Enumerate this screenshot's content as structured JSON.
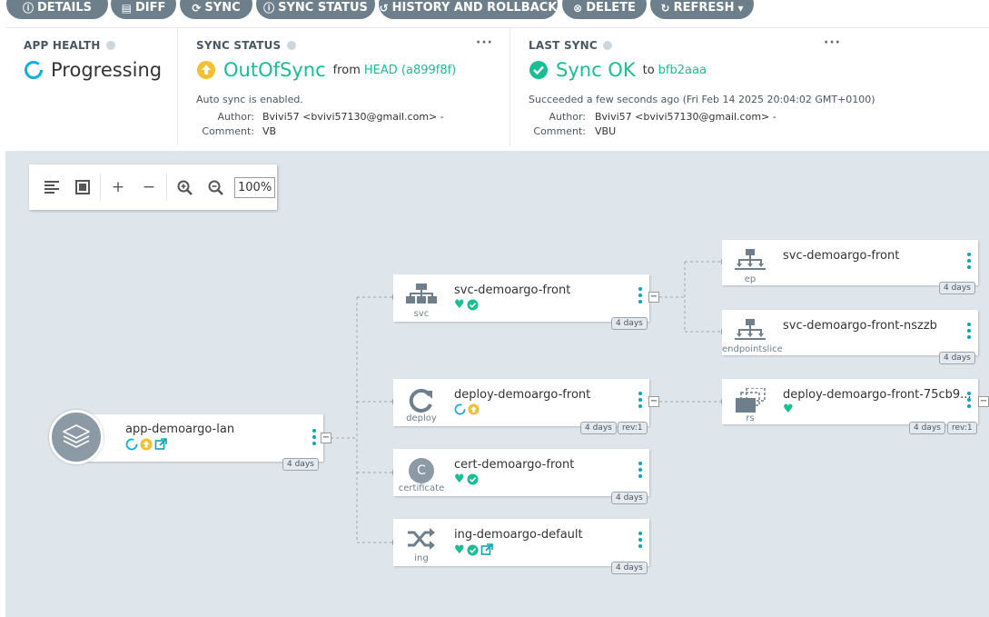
{
  "toolbar": {
    "buttons": [
      {
        "label": "DETAILS",
        "icon": "info-circle-icon"
      },
      {
        "label": "DIFF",
        "icon": "file-diff-icon"
      },
      {
        "label": "SYNC",
        "icon": "sync-icon"
      },
      {
        "label": "SYNC STATUS",
        "icon": "info-circle-icon"
      },
      {
        "label": "HISTORY AND ROLLBACK",
        "icon": "history-icon"
      },
      {
        "label": "DELETE",
        "icon": "times-circle-icon"
      },
      {
        "label": "REFRESH",
        "icon": "redo-icon"
      }
    ]
  },
  "app_health": {
    "title": "APP HEALTH",
    "value": "Progressing"
  },
  "sync_status": {
    "title": "SYNC STATUS",
    "value": "OutOfSync",
    "from_text": "from",
    "revision": "HEAD (a899f8f)",
    "auto_sync": "Auto sync is enabled.",
    "author_label": "Author:",
    "author": "Bvivi57 <bvivi57130@gmail.com> -",
    "comment_label": "Comment:",
    "comment": "VB"
  },
  "last_sync": {
    "title": "LAST SYNC",
    "value": "Sync OK",
    "to_text": "to",
    "revision": "bfb2aaa",
    "succeeded": "Succeeded a few seconds ago (Fri Feb 14 2025 20:04:02 GMT+0100)",
    "author_label": "Author:",
    "author": "Bvivi57 <bvivi57130@gmail.com> -",
    "comment_label": "Comment:",
    "comment": "VBU"
  },
  "zoom": {
    "level": "100%"
  },
  "graph": {
    "app": {
      "name": "app-demoargo-lan",
      "age": "4 days"
    },
    "nodes": [
      {
        "name": "svc-demoargo-front",
        "kind": "svc",
        "age": "4 days"
      },
      {
        "name": "deploy-demoargo-front",
        "kind": "deploy",
        "age": "4 days",
        "rev": "rev:1"
      },
      {
        "name": "cert-demoargo-front",
        "kind": "certificate",
        "age": "4 days",
        "icon_letter": "C"
      },
      {
        "name": "ing-demoargo-default",
        "kind": "ing",
        "age": "4 days"
      },
      {
        "name": "svc-demoargo-front",
        "kind": "ep",
        "age": "4 days"
      },
      {
        "name": "svc-demoargo-front-nszzb",
        "kind": "endpointslice",
        "age": "4 days"
      },
      {
        "name": "deploy-demoargo-front-75cb9...",
        "kind": "rs",
        "age": "4 days",
        "rev": "rev:1"
      }
    ]
  },
  "colors": {
    "healthy": "#18be94",
    "progressing": "#0dadea",
    "out_of_sync": "#f4c030",
    "button_bg": "#6d7f8b",
    "graph_bg": "#dee6eb"
  }
}
